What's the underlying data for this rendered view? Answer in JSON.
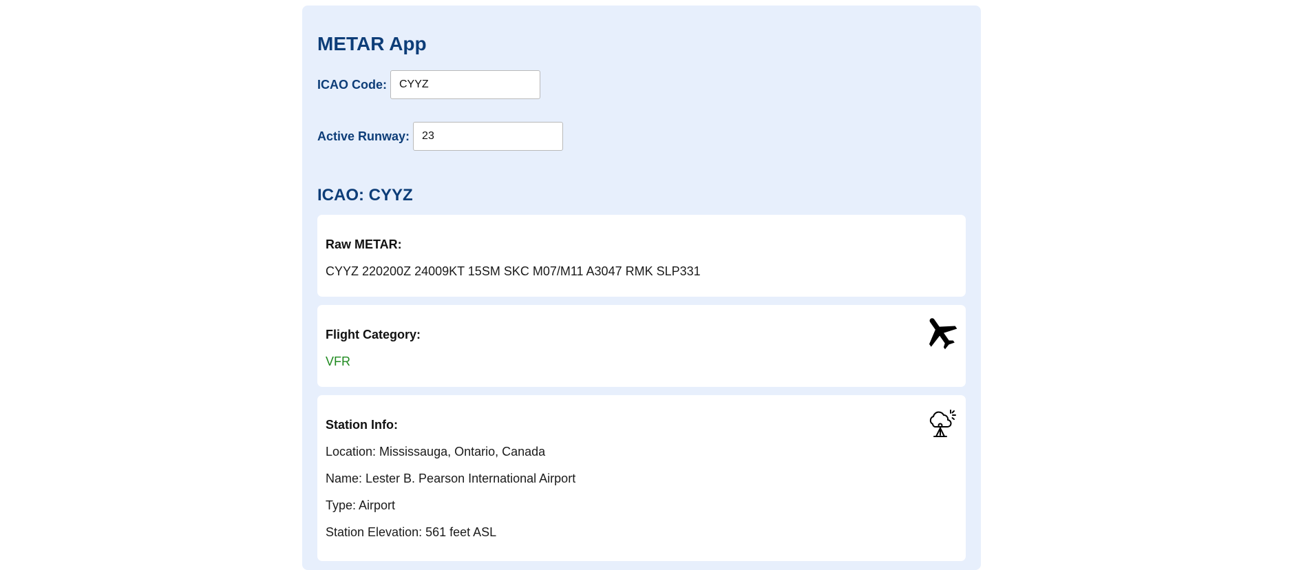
{
  "app": {
    "title": "METAR App"
  },
  "form": {
    "icao_label": "ICAO Code:",
    "icao_value": "CYYZ",
    "runway_label": "Active Runway:",
    "runway_value": "23"
  },
  "result": {
    "heading": "ICAO: CYYZ",
    "raw_metar": {
      "label": "Raw METAR:",
      "value": "CYYZ 220200Z 24009KT 15SM SKC M07/M11 A3047 RMK SLP331"
    },
    "flight_category": {
      "label": "Flight Category:",
      "value": "VFR",
      "value_color": "#1f8a1f",
      "icon": "airplane-icon"
    },
    "station_info": {
      "label": "Station Info:",
      "location": "Location: Mississauga, Ontario, Canada",
      "name": "Name: Lester B. Pearson International Airport",
      "type": "Type: Airport",
      "elevation": "Station Elevation: 561 feet ASL",
      "icon": "weather-station-icon"
    }
  },
  "colors": {
    "panel_background": "#e7effc",
    "heading_color": "#0d3d78"
  }
}
